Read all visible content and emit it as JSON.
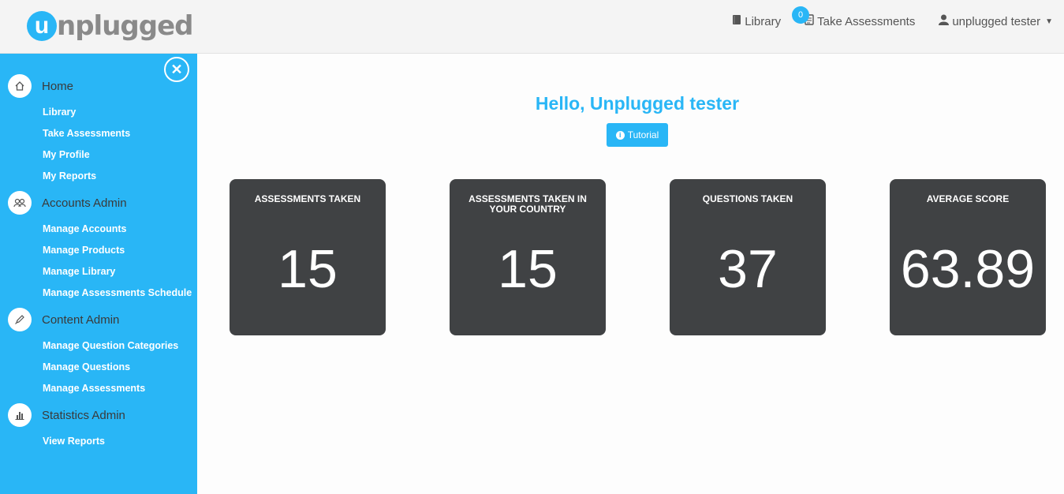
{
  "brand": {
    "logo_letter": "u",
    "logo_text": "nplugged"
  },
  "navbar": {
    "library": "Library",
    "take_assessments": "Take Assessments",
    "take_assessments_badge": "0",
    "user": "unplugged tester"
  },
  "sidebar": {
    "sections": [
      {
        "label": "Home",
        "icon": "home-icon",
        "items": [
          "Library",
          "Take Assessments",
          "My Profile",
          "My Reports"
        ]
      },
      {
        "label": "Accounts Admin",
        "icon": "users-icon",
        "items": [
          "Manage Accounts",
          "Manage Products",
          "Manage Library",
          "Manage Assessments Schedule"
        ]
      },
      {
        "label": "Content Admin",
        "icon": "pencil-icon",
        "items": [
          "Manage Question Categories",
          "Manage Questions",
          "Manage Assessments"
        ]
      },
      {
        "label": "Statistics Admin",
        "icon": "bar-chart-icon",
        "items": [
          "View Reports"
        ]
      }
    ]
  },
  "main": {
    "greeting": "Hello, Unplugged tester",
    "tutorial_label": "Tutorial",
    "cards": [
      {
        "title": "ASSESSMENTS TAKEN",
        "value": "15"
      },
      {
        "title": "ASSESSMENTS TAKEN IN YOUR COUNTRY",
        "value": "15"
      },
      {
        "title": "QUESTIONS TAKEN",
        "value": "37"
      },
      {
        "title": "AVERAGE SCORE",
        "value": "63.89"
      }
    ]
  },
  "colors": {
    "accent": "#29b6f6",
    "card_bg": "#404244",
    "topbar_bg": "#f4f4f4"
  }
}
